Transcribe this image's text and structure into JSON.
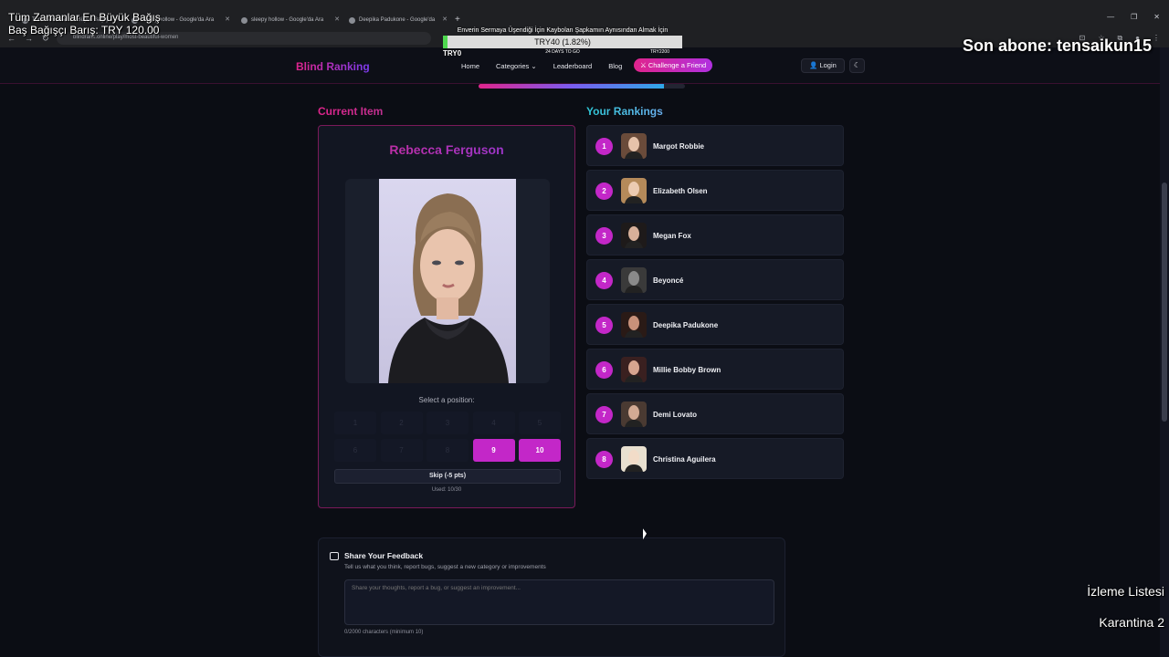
{
  "browser": {
    "tabs": [
      {
        "title": "Tüm Zamanlar En Büyük Bağış"
      },
      {
        "title": "sleepy hollow - Google'da Ara"
      },
      {
        "title": "sleepy hollow - Google'da Ara"
      },
      {
        "title": "Deepika Padukone - Google'da"
      }
    ],
    "url": "blindrank.online/play/most-beautiful-women"
  },
  "overlay": {
    "donation_line1": "Tüm Zamanlar En Büyük Bağış",
    "donation_line2": "Baş Bağışçı Barış: TRY 120.00",
    "subscriber": "Son abone: tensaikun15",
    "goal_title": "Enverin Sermaya Üşendiği İçin Kaybolan Şapkamın Aynısından Almak İçin",
    "goal_value": "TRY40 (1.82%)",
    "goal_progress": 0.0182,
    "goal_min": "TRY0",
    "goal_days": "24 DAYS TO GO",
    "goal_max": "TRY2200",
    "watchlist": "İzleme Listesi",
    "quarantine": "Karantina 2"
  },
  "nav": {
    "brand": "Blind Ranking",
    "links": [
      "Home",
      "Categories",
      "Leaderboard",
      "Blog"
    ],
    "challenge": "Challenge a Friend",
    "login": "Login",
    "progress": 0.9
  },
  "current": {
    "section_title": "Current Item",
    "name": "Rebecca Ferguson",
    "select_label": "Select a position:",
    "positions": [
      "1",
      "2",
      "3",
      "4",
      "5",
      "6",
      "7",
      "8",
      "9",
      "10"
    ],
    "active_positions": [
      "9",
      "10"
    ],
    "skip_label": "Skip (-5 pts)",
    "used_label": "Used: 10/30"
  },
  "rankings": {
    "section_title": "Your Rankings",
    "items": [
      {
        "rank": "1",
        "name": "Margot Robbie"
      },
      {
        "rank": "2",
        "name": "Elizabeth Olsen"
      },
      {
        "rank": "3",
        "name": "Megan Fox"
      },
      {
        "rank": "4",
        "name": "Beyoncé"
      },
      {
        "rank": "5",
        "name": "Deepika Padukone"
      },
      {
        "rank": "6",
        "name": "Millie Bobby Brown"
      },
      {
        "rank": "7",
        "name": "Demi Lovato"
      },
      {
        "rank": "8",
        "name": "Christina Aguilera"
      }
    ]
  },
  "feedback": {
    "title": "Share Your Feedback",
    "description": "Tell us what you think, report bugs, suggest a new category or improvements",
    "placeholder": "Share your thoughts, report a bug, or suggest an improvement...",
    "counter": "0/2000 characters (minimum 10)"
  }
}
